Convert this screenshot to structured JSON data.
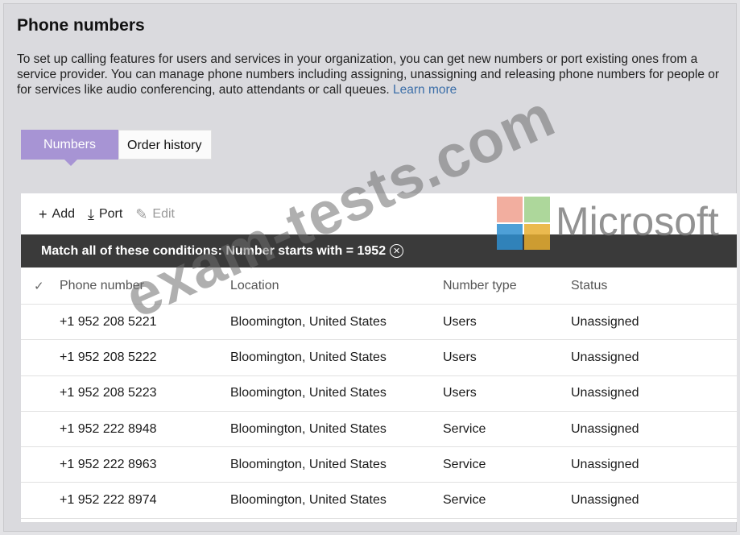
{
  "header": {
    "title": "Phone numbers",
    "description": "To set up calling features for users and services in your organization, you can get new numbers or port existing ones from a service provider. You can manage phone numbers including assigning, unassigning and releasing phone numbers for people or for services like audio conferencing, auto attendants or call queues.",
    "learn_more": "Learn more"
  },
  "tabs": [
    {
      "label": "Numbers",
      "active": true
    },
    {
      "label": "Order history",
      "active": false
    }
  ],
  "toolbar": {
    "add_label": "Add",
    "port_label": "Port",
    "edit_label": "Edit"
  },
  "filter": {
    "text": "Match all of these conditions: Number starts with = 1952"
  },
  "table": {
    "columns": [
      "Phone number",
      "Location",
      "Number type",
      "Status"
    ],
    "rows": [
      [
        "+1 952 208 5221",
        "Bloomington, United States",
        "Users",
        "Unassigned"
      ],
      [
        "+1 952 208 5222",
        "Bloomington, United States",
        "Users",
        "Unassigned"
      ],
      [
        "+1 952 208 5223",
        "Bloomington, United States",
        "Users",
        "Unassigned"
      ],
      [
        "+1 952 222 8948",
        "Bloomington, United States",
        "Service",
        "Unassigned"
      ],
      [
        "+1 952 222 8963",
        "Bloomington, United States",
        "Service",
        "Unassigned"
      ],
      [
        "+1 952 222 8974",
        "Bloomington, United States",
        "Service",
        "Unassigned"
      ]
    ]
  },
  "watermark": {
    "text": "exam-tests.com",
    "brand": "Microsoft"
  },
  "colors": {
    "tab_active": "#a794d4",
    "filter_bar": "#3a3a3a",
    "link": "#3b6ea8",
    "ms_red": "#f0a08e",
    "ms_green": "#9fd08a",
    "ms_blue": "#2f8fd0",
    "ms_yellow": "#e8ae30"
  }
}
